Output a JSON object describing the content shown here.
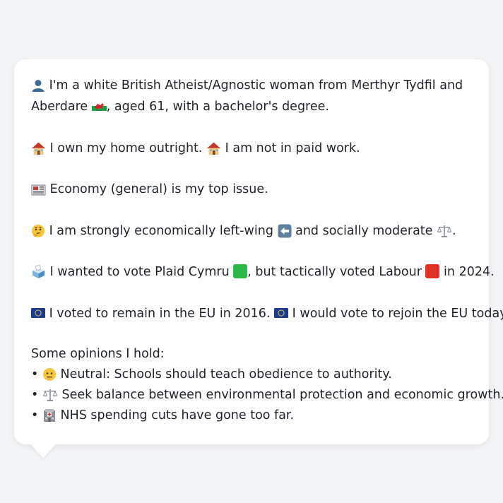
{
  "persona": {
    "identity_text_1": "I'm a white British Atheist/Agnostic woman from Merthyr Tydfil and Aberdare",
    "identity_text_2": ", aged 61, with a bachelor's degree.",
    "home_text_1": "I own my home outright.",
    "home_text_2": "I am not in paid work.",
    "issue_text": "Economy (general) is my top issue.",
    "ideology_text_1": "I am strongly economically left-wing",
    "ideology_text_2": "and socially moderate",
    "ideology_text_3": ".",
    "vote_text_1": "I wanted to vote Plaid Cymru",
    "vote_text_2": ", but tactically voted Labour",
    "vote_text_3": "in 2024.",
    "eu_text_1": "I voted to remain in the EU in 2016.",
    "eu_text_2": "I would vote to rejoin the EU today.",
    "opinions_title": "Some opinions I hold:",
    "opinions": [
      "Neutral: Schools should teach obedience to authority.",
      "Seek balance between environmental protection and economic growth.",
      "NHS spending cuts have gone too far."
    ],
    "bullet": "•"
  },
  "colors": {
    "plaid_cymru": "#2fb84a",
    "labour": "#e0302a",
    "eu_blue": "#1d3c8f",
    "wales_red": "#d3232b",
    "wales_green": "#1f9e48"
  },
  "icons": {
    "identity": "person-icon",
    "home": "house-icon",
    "issue": "newspaper-icon",
    "ideology": "thinking-face-icon",
    "left": "left-arrow-icon",
    "balance": "scales-icon",
    "vote": "ballot-box-icon",
    "eu": "eu-flag-icon",
    "neutral": "neutral-face-icon",
    "hospital": "hospital-icon"
  }
}
